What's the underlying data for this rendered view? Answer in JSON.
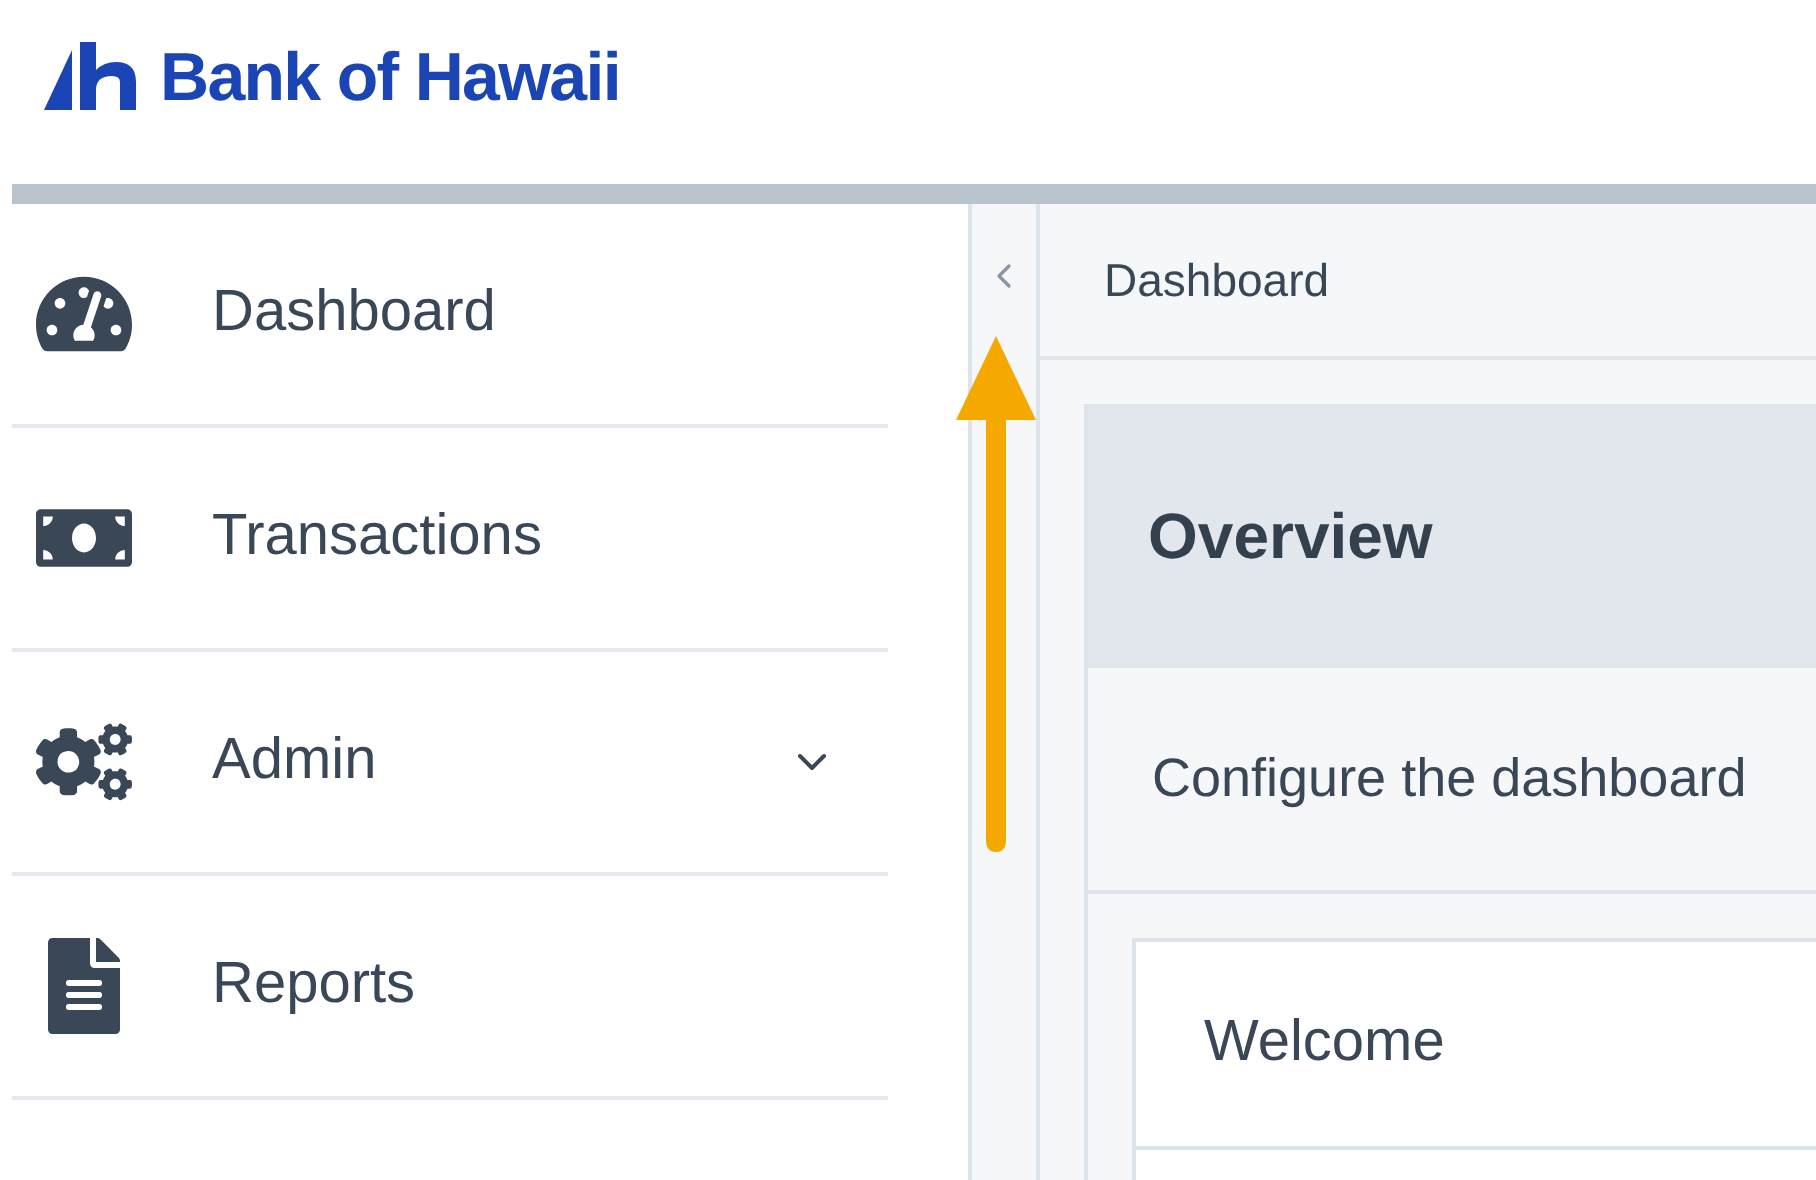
{
  "logo": {
    "text": "Bank of Hawaii"
  },
  "sidebar": {
    "items": [
      {
        "label": "Dashboard",
        "kind": "gauge",
        "has_submenu": false
      },
      {
        "label": "Transactions",
        "kind": "money",
        "has_submenu": false
      },
      {
        "label": "Admin",
        "kind": "cogs",
        "has_submenu": true
      },
      {
        "label": "Reports",
        "kind": "file",
        "has_submenu": false
      }
    ]
  },
  "breadcrumb": "Dashboard",
  "card": {
    "title": "Overview",
    "description": "Configure the dashboard",
    "panel_title": "Welcome"
  },
  "annotation": {
    "kind": "arrow"
  }
}
